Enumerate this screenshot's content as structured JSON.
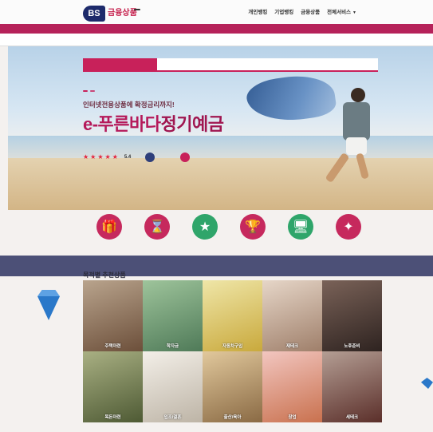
{
  "header": {
    "logo_bs": "BS",
    "logo_name": "금융상품",
    "logo_badge": "",
    "nav": [
      "개인뱅킹",
      "기업뱅킹",
      "금융상품",
      "전체서비스"
    ]
  },
  "main_nav": [
    "",
    "",
    "",
    "",
    "",
    "",
    "",
    "",
    "",
    ""
  ],
  "subbar": {
    "breadcrumb": "",
    "sitemap": ""
  },
  "hero": {
    "tabs": [
      "",
      "",
      "",
      ""
    ],
    "active_tab": 0,
    "tags": [
      "",
      ""
    ],
    "subtitle": "인터넷전용상품에 확정금리까지!",
    "headline_a": "e-푸른바다",
    "headline_b": "정기예금",
    "description": "",
    "rating_stars": 5,
    "rating_score": "5.4",
    "button_1": "",
    "button_2": ""
  },
  "quick_icons": [
    {
      "label": "",
      "color": "#c6295d",
      "icon": "gift-icon"
    },
    {
      "label": "",
      "color": "#c6295d",
      "icon": "hourglass-icon"
    },
    {
      "label": "",
      "color": "#2fa56a",
      "icon": "star-icon"
    },
    {
      "label": "",
      "color": "#c6295d",
      "icon": "trophy-icon"
    },
    {
      "label": "",
      "color": "#2fa56a",
      "icon": "monitor-icon"
    },
    {
      "label": "",
      "color": "#c6295d",
      "icon": "wand-icon"
    }
  ],
  "band": {
    "tabs": [
      "",
      "",
      "",
      "",
      "",
      "",
      "",
      "",
      ""
    ]
  },
  "section": {
    "title": "목적별 추천상품",
    "description": ""
  },
  "grid": [
    {
      "label": "주택마련",
      "bg": "#8a6a52"
    },
    {
      "label": "학자금",
      "bg": "#6a8f72"
    },
    {
      "label": "자동차구입",
      "bg": "#c9b06a"
    },
    {
      "label": "재테크",
      "bg": "#b79a86"
    },
    {
      "label": "노후준비",
      "bg": "#4a3a33"
    },
    {
      "label": "목돈마련",
      "bg": "#6f7a52"
    },
    {
      "label": "입조/결혼",
      "bg": "#d8d2c6"
    },
    {
      "label": "출산/육아",
      "bg": "#a0825a"
    },
    {
      "label": "창업",
      "bg": "#e0a6a8"
    },
    {
      "label": "세테크",
      "bg": "#7a6a62"
    }
  ],
  "colors": {
    "brand": "#c8215a",
    "nav_bg": "#b6225a",
    "band_bg": "#4c5077"
  }
}
